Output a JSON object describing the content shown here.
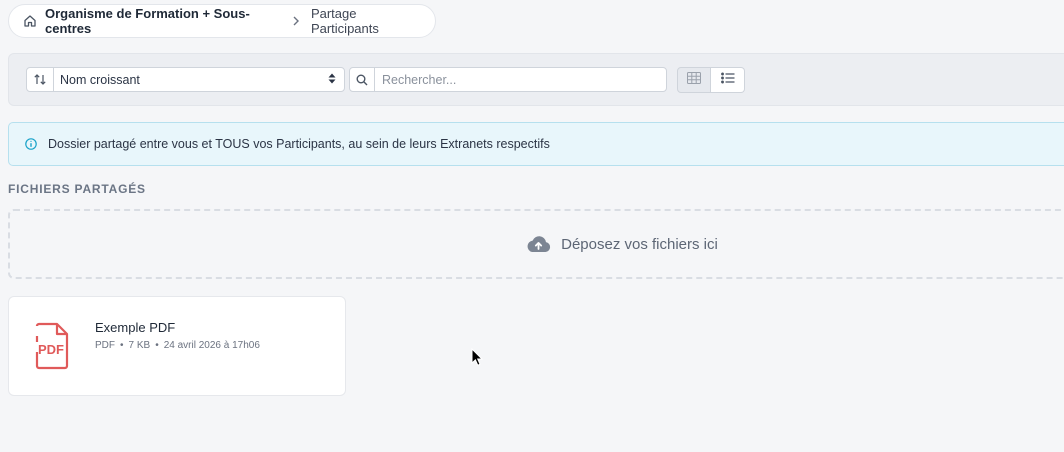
{
  "breadcrumb": {
    "home_icon": "home-icon",
    "root": "Organisme de Formation + Sous-centres",
    "current": "Partage Participants"
  },
  "toolbar": {
    "sort_icon": "sort-arrows-icon",
    "sort_value": "Nom croissant",
    "search_icon": "search-icon",
    "search_placeholder": "Rechercher...",
    "views": [
      "grid-view",
      "list-view"
    ],
    "active_view": "list-view"
  },
  "alert": {
    "icon": "info-icon",
    "text": "Dossier partagé entre vous et TOUS vos Participants, au sein de leurs Extranets respectifs"
  },
  "section": {
    "title": "FICHIERS PARTAGÉS"
  },
  "dropzone": {
    "icon": "cloud-upload-icon",
    "text": "Déposez vos fichiers ici"
  },
  "files": [
    {
      "icon": "pdf-file-icon",
      "name": "Exemple PDF",
      "type": "PDF",
      "size": "7 KB",
      "date": "24 avril 2026 à 17h06"
    }
  ],
  "colors": {
    "accent_info": "#1aa3c9",
    "pdf_red": "#e05a5a",
    "background": "#f5f6f8"
  }
}
